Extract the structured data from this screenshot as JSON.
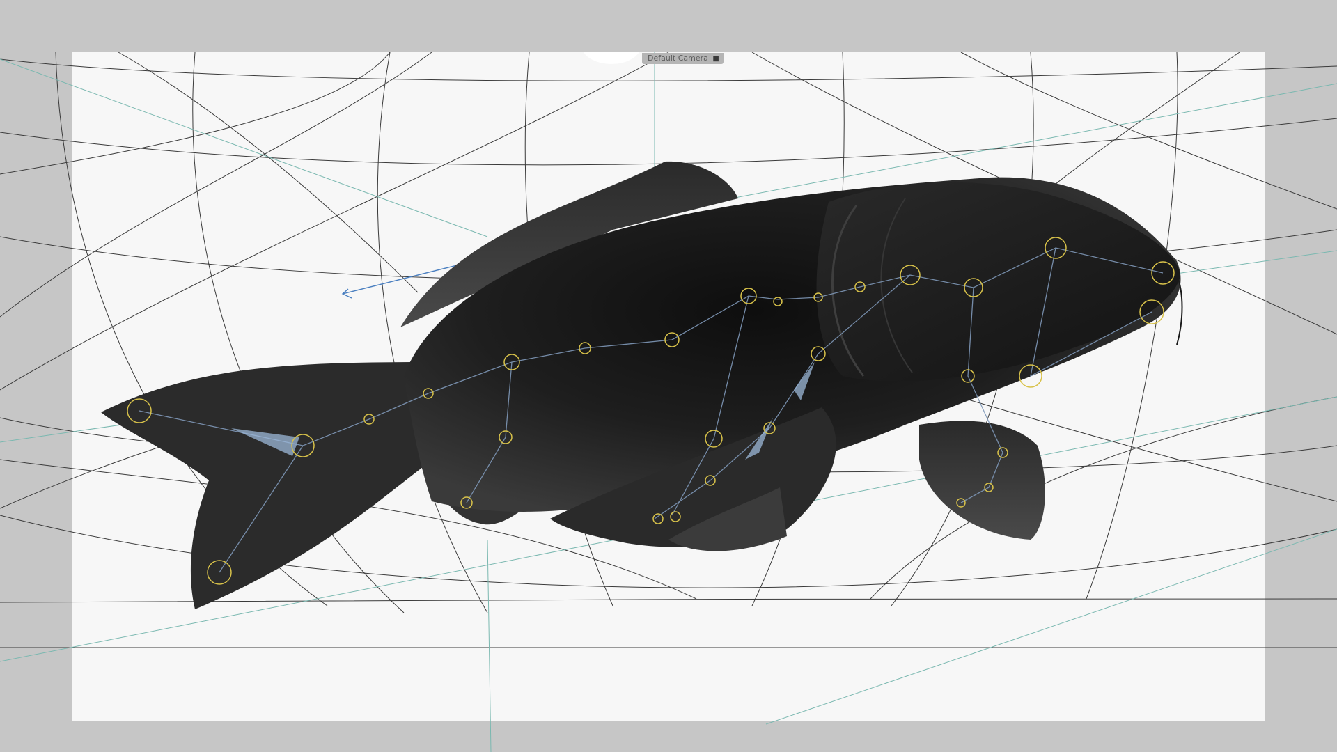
{
  "viewport": {
    "camera_label": "Default Camera",
    "camera_icon": "camera-icon"
  },
  "colors": {
    "outer_background": "#c6c6c6",
    "safe_frame": "#f7f7f7",
    "wireframe": "#3a3a3a",
    "guide_lines": "#7ab8b0",
    "mesh_dark": "#1c1c1c",
    "joint_ring": "#d8c24a",
    "bone": "#8fa9c9"
  },
  "scene": {
    "object": "fish-mesh",
    "rig": "skeleton-joints"
  }
}
